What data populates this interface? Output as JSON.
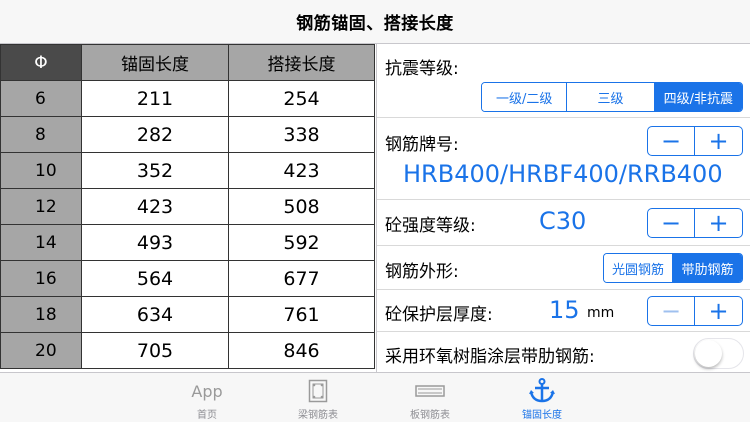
{
  "nav": {
    "title": "钢筋锚固、搭接长度"
  },
  "table": {
    "headers": [
      "Φ",
      "锚固长度",
      "搭接长度"
    ],
    "rows": [
      [
        "6",
        "211",
        "254"
      ],
      [
        "8",
        "282",
        "338"
      ],
      [
        "10",
        "352",
        "423"
      ],
      [
        "12",
        "423",
        "508"
      ],
      [
        "14",
        "493",
        "592"
      ],
      [
        "16",
        "564",
        "677"
      ],
      [
        "18",
        "634",
        "761"
      ],
      [
        "20",
        "705",
        "846"
      ]
    ]
  },
  "settings": {
    "seismic": {
      "label": "抗震等级:",
      "options": [
        "一级/二级",
        "三级",
        "四级/非抗震"
      ],
      "selected": "四级/非抗震"
    },
    "grade": {
      "label": "钢筋牌号:",
      "value": "HRB400/HRBF400/RRB400"
    },
    "concrete": {
      "label": "砼强度等级:",
      "value": "C30"
    },
    "shape": {
      "label": "钢筋外形:",
      "options": [
        "光圆钢筋",
        "带肋钢筋"
      ],
      "selected": "带肋钢筋"
    },
    "cover": {
      "label": "砼保护层厚度:",
      "value": "15",
      "unit": "mm"
    },
    "epoxy": {
      "label": "采用环氧树脂涂层带肋钢筋:",
      "on": false
    },
    "minus": "−",
    "plus": "+"
  },
  "tabs": [
    {
      "label": "首页",
      "icon_text": "App"
    },
    {
      "label": "梁钢筋表"
    },
    {
      "label": "板钢筋表"
    },
    {
      "label": "锚固长度"
    }
  ],
  "colors": {
    "accent": "#1a73e8",
    "header_dark": "#4a4a4a",
    "header_gray": "#a6a6a6"
  }
}
